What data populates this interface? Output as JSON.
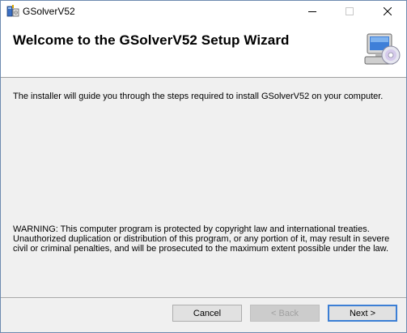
{
  "window": {
    "title": "GSolverV52",
    "controls": {
      "minimize_icon": "minimize-icon",
      "maximize_icon": "maximize-icon",
      "close_icon": "close-icon"
    }
  },
  "banner": {
    "title": "Welcome to the GSolverV52 Setup Wizard",
    "icon": "computer-cd-icon"
  },
  "main": {
    "intro": "The installer will guide you through the steps required to install GSolverV52 on your computer.",
    "warning": "WARNING: This computer program is protected by copyright law and international treaties. Unauthorized duplication or distribution of this program, or any portion of it, may result in severe civil or criminal penalties, and will be prosecuted to the maximum extent possible under the law."
  },
  "footer": {
    "cancel_label": "Cancel",
    "back_label": "< Back",
    "next_label": "Next >"
  },
  "colors": {
    "focus_border": "#3c7fd5",
    "disabled_text": "#a0a0a0"
  }
}
